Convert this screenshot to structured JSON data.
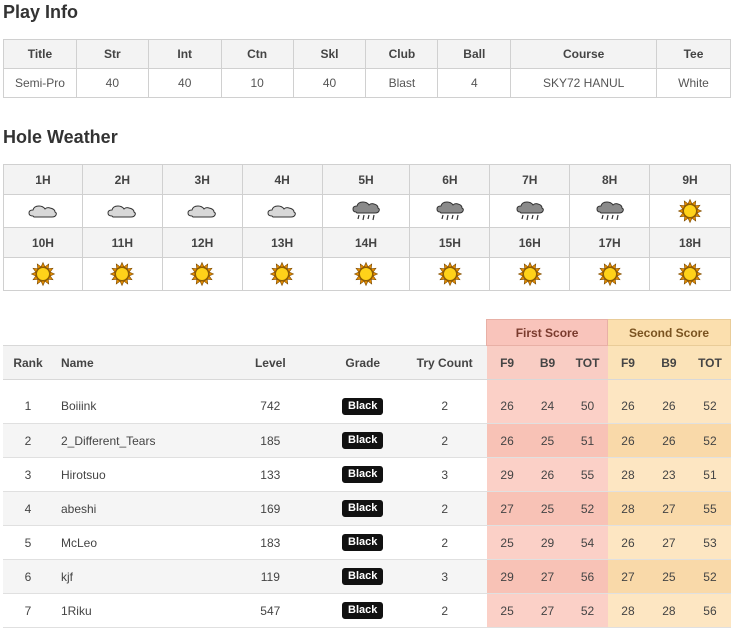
{
  "play_info": {
    "title": "Play Info",
    "headers": [
      "Title",
      "Str",
      "Int",
      "Ctn",
      "Skl",
      "Club",
      "Ball",
      "Course",
      "Tee"
    ],
    "values": [
      "Semi-Pro",
      "40",
      "40",
      "10",
      "40",
      "Blast",
      "4",
      "SKY72 HANUL",
      "White"
    ]
  },
  "hole_weather": {
    "title": "Hole Weather",
    "front_holes": [
      "1H",
      "2H",
      "3H",
      "4H",
      "5H",
      "6H",
      "7H",
      "8H",
      "9H"
    ],
    "front_icons": [
      "cloud-icon",
      "cloud-icon",
      "cloud-icon",
      "cloud-icon",
      "rain-cloud-icon",
      "rain-cloud-icon",
      "rain-cloud-icon",
      "rain-cloud-icon",
      "sun-icon"
    ],
    "back_holes": [
      "10H",
      "11H",
      "12H",
      "13H",
      "14H",
      "15H",
      "16H",
      "17H",
      "18H"
    ],
    "back_icons": [
      "sun-icon",
      "sun-icon",
      "sun-icon",
      "sun-icon",
      "sun-icon",
      "sun-icon",
      "sun-icon",
      "sun-icon",
      "sun-icon"
    ]
  },
  "ranking": {
    "group_first": "First Score",
    "group_second": "Second Score",
    "headers": {
      "rank": "Rank",
      "name": "Name",
      "level": "Level",
      "grade": "Grade",
      "try_count": "Try Count",
      "f9": "F9",
      "b9": "B9",
      "tot": "TOT"
    },
    "rows": [
      {
        "rank": "1",
        "name": "Boiiink",
        "level": "742",
        "grade": "Black",
        "try": "2",
        "first": [
          "26",
          "24",
          "50"
        ],
        "second": [
          "26",
          "26",
          "52"
        ]
      },
      {
        "rank": "2",
        "name": "2_Different_Tears",
        "level": "185",
        "grade": "Black",
        "try": "2",
        "first": [
          "26",
          "25",
          "51"
        ],
        "second": [
          "26",
          "26",
          "52"
        ]
      },
      {
        "rank": "3",
        "name": "Hirotsuo",
        "level": "133",
        "grade": "Black",
        "try": "3",
        "first": [
          "29",
          "26",
          "55"
        ],
        "second": [
          "28",
          "23",
          "51"
        ]
      },
      {
        "rank": "4",
        "name": "abeshi",
        "level": "169",
        "grade": "Black",
        "try": "2",
        "first": [
          "27",
          "25",
          "52"
        ],
        "second": [
          "28",
          "27",
          "55"
        ]
      },
      {
        "rank": "5",
        "name": "McLeo",
        "level": "183",
        "grade": "Black",
        "try": "2",
        "first": [
          "25",
          "29",
          "54"
        ],
        "second": [
          "26",
          "27",
          "53"
        ]
      },
      {
        "rank": "6",
        "name": "kjf",
        "level": "119",
        "grade": "Black",
        "try": "3",
        "first": [
          "29",
          "27",
          "56"
        ],
        "second": [
          "27",
          "25",
          "52"
        ]
      },
      {
        "rank": "7",
        "name": "1Riku",
        "level": "547",
        "grade": "Black",
        "try": "2",
        "first": [
          "25",
          "27",
          "52"
        ],
        "second": [
          "28",
          "28",
          "56"
        ]
      }
    ]
  }
}
